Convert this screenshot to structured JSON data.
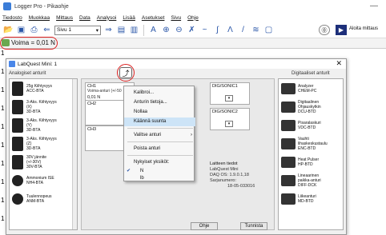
{
  "window": {
    "title": "Logger Pro - Pikaohje",
    "minimize": "—"
  },
  "menu": [
    "Tiedosto",
    "Muokkaa",
    "Mittaus",
    "Data",
    "Analysoi",
    "Lisää",
    "Asetukset",
    "Sivu",
    "Ohje"
  ],
  "toolbar": {
    "page_select": "Sivu 1",
    "collect_label": "Aloita mittaus"
  },
  "meter": {
    "label": "Voima = 0,01 N"
  },
  "background_rows": [
    "1",
    "1",
    "1",
    "1",
    "1",
    "1",
    "1",
    "1",
    "1",
    "1"
  ],
  "dialog": {
    "title": "LabQuest Mini: 1",
    "analog_heading": "Analogiset anturit",
    "digital_heading": "Digitaaliset anturit",
    "ok": "Ohje",
    "cancel": "Tunnista"
  },
  "analog_sensors": [
    "25g Kiihtyvyys\nACC-BTA",
    "3-Aks. Kiihtyvyys\n(X)\n3D-BTA",
    "3-Aks. Kiihtyvyys\n(Y)\n3D-BTA",
    "3-Aks. Kiihtyvyys\n(Z)\n3D-BTA",
    "30V jännite\n(+/-30V)\n30V-BTA",
    "Ammonium ISE\nNH4-BTA",
    "Tuulennopeus\nANM-BTA"
  ],
  "digital_sensors": [
    "Analyzer\nCHEM-PC",
    "Digitaalinen\nOhjauskytkin\nDCU-BTD",
    "Pisaralaskuri\nVDC-BTD",
    "Vauhti\nlihaskeskustaulu\nENC-BTD",
    "Heat Pulser\nHP-BTD",
    "Lineaarinen\npaikka-anturi\nDIFF-DCK",
    "Liikeanturi\nMD-BTD"
  ],
  "channels": {
    "ch1_label": "CH1",
    "ch1_sub": "Voima-anturi (+/-50",
    "ch1_value": "0,01 N",
    "ch2_label": "CH2",
    "ch3_label": "CH3",
    "dig1_label": "DIG/SONIC1",
    "dig2_label": "DIG/SONIC2"
  },
  "device_info": {
    "heading": "Laitteen tiedot",
    "name": "LabQuest Mini",
    "daq": "DAQ OS: 1.9.0.1,18",
    "serial_label": "Sarjanumero:",
    "serial": "18-05-033016"
  },
  "context_menu": {
    "items": [
      "Kalibroi...",
      "Anturin tietoja...",
      "Nollaa",
      "Käännä suunta",
      "Valitse anturi",
      "Poista anturi"
    ],
    "units_heading": "Nykyiset yksiköt:",
    "units": [
      "N",
      "lb"
    ]
  }
}
